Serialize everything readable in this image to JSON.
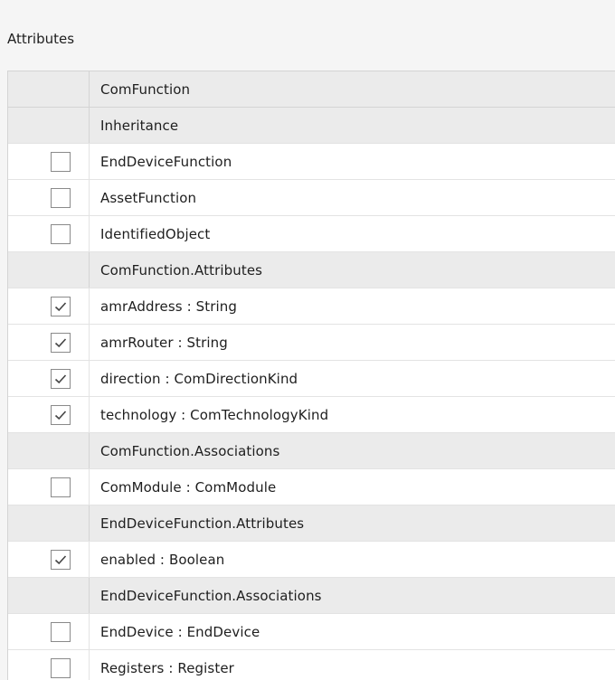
{
  "panel": {
    "title": "Attributes"
  },
  "grid": {
    "header": "ComFunction",
    "rows": [
      {
        "type": "group",
        "label": "Inheritance"
      },
      {
        "type": "item",
        "label": "EndDeviceFunction",
        "checked": false
      },
      {
        "type": "item",
        "label": "AssetFunction",
        "checked": false
      },
      {
        "type": "item",
        "label": "IdentifiedObject",
        "checked": false
      },
      {
        "type": "group",
        "label": "ComFunction.Attributes"
      },
      {
        "type": "item",
        "label": "amrAddress : String",
        "checked": true
      },
      {
        "type": "item",
        "label": "amrRouter : String",
        "checked": true
      },
      {
        "type": "item",
        "label": "direction : ComDirectionKind",
        "checked": true
      },
      {
        "type": "item",
        "label": "technology : ComTechnologyKind",
        "checked": true
      },
      {
        "type": "group",
        "label": "ComFunction.Associations"
      },
      {
        "type": "item",
        "label": "ComModule : ComModule",
        "checked": false
      },
      {
        "type": "group",
        "label": "EndDeviceFunction.Attributes"
      },
      {
        "type": "item",
        "label": "enabled : Boolean",
        "checked": true
      },
      {
        "type": "group",
        "label": "EndDeviceFunction.Associations"
      },
      {
        "type": "item",
        "label": "EndDevice : EndDevice",
        "checked": false
      },
      {
        "type": "item",
        "label": "Registers : Register",
        "checked": false
      }
    ]
  },
  "icons": {
    "checkmark": "checkmark-icon"
  },
  "colors": {
    "header_bg": "#ebebeb",
    "row_bg": "#ffffff",
    "checkbox_border": "#8a8a8a",
    "checkmark": "#444444"
  }
}
